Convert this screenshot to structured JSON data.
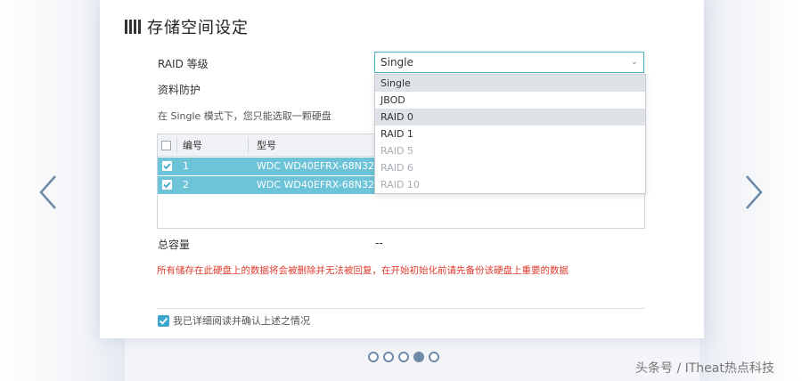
{
  "header": {
    "title": "存储空间设定"
  },
  "form": {
    "raid_label": "RAID 等级",
    "raid_value": "Single",
    "protection_label": "资料防护",
    "hint": "在 Single 模式下，您只能选取一颗硬盘",
    "total_capacity_label": "总容量",
    "total_capacity_value": "--",
    "warning": "所有储存在此硬盘上的数据将会被删除并无法被回复，在开始初始化前请先备份该硬盘上重要的数据",
    "confirm_label": "我已详细阅读并确认上述之情况"
  },
  "dropdown": {
    "options": [
      {
        "label": "Single",
        "state": "selected"
      },
      {
        "label": "JBOD",
        "state": "enabled"
      },
      {
        "label": "RAID 0",
        "state": "hover"
      },
      {
        "label": "RAID 1",
        "state": "enabled"
      },
      {
        "label": "RAID 5",
        "state": "disabled"
      },
      {
        "label": "RAID 6",
        "state": "disabled"
      },
      {
        "label": "RAID 10",
        "state": "disabled"
      }
    ]
  },
  "disk_table": {
    "columns": [
      "编号",
      "型号"
    ],
    "rows": [
      {
        "number": "1",
        "model": "WDC WD40EFRX-68N32N0",
        "checked": true
      },
      {
        "number": "2",
        "model": "WDC WD40EFRX-68N32N0",
        "checked": true
      }
    ]
  },
  "pager": {
    "total": 5,
    "active_index": 3
  },
  "icons": {
    "prev": "chevron-left-icon",
    "next": "chevron-right-icon",
    "title": "bars-icon",
    "dropdown": "chevron-down-icon"
  },
  "colors": {
    "accent": "#4fb0c6",
    "row_selected": "#6dc3d8",
    "warning": "#e03a2e",
    "nav": "#6e8aa8"
  },
  "watermark": "头条号 / ITheat热点科技"
}
